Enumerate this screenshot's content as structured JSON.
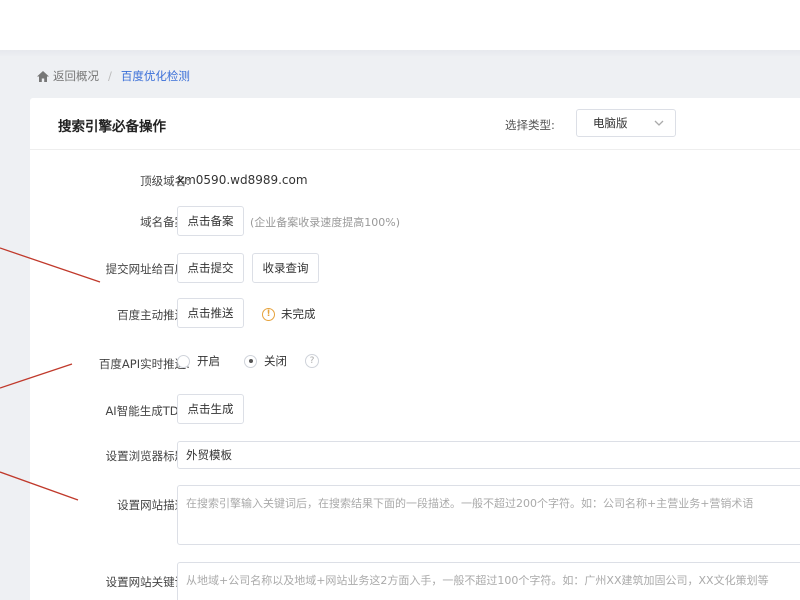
{
  "breadcrumb": {
    "back": "返回概况",
    "separator": "/",
    "current": "百度优化检测"
  },
  "panel": {
    "title": "搜索引擎必备操作",
    "type_label": "选择类型:",
    "type_value": "电脑版"
  },
  "rows": {
    "domain": {
      "label": "顶级域名:",
      "value": "xm0590.wd8989.com"
    },
    "record": {
      "label": "域名备案:",
      "button": "点击备案",
      "hint": "(企业备案收录速度提高100%)"
    },
    "submit": {
      "label": "提交网址给百度:",
      "button": "点击提交",
      "button2": "收录查询"
    },
    "push": {
      "label": "百度主动推送:",
      "button": "点击推送",
      "status_icon": "!",
      "status": "未完成"
    },
    "api": {
      "label": "百度API实时推送:",
      "option_on": "开启",
      "option_off": "关闭",
      "selected": "关闭",
      "help": "?"
    },
    "tdk": {
      "label": "AI智能生成TDK:",
      "button": "点击生成"
    },
    "browser_title": {
      "label": "设置浏览器标题:",
      "value": "外贸模板"
    },
    "description": {
      "label": "设置网站描述:",
      "placeholder": "在搜索引擎输入关键词后，在搜索结果下面的一段描述。一般不超过200个字符。如：公司名称+主营业务+营销术语"
    },
    "keywords": {
      "label": "设置网站关键词:",
      "placeholder": "从地域+公司名称以及地域+网站业务这2方面入手，一般不超过100个字符。如：广州XX建筑加固公司，XX文化策划等"
    }
  },
  "colors": {
    "accent": "#3a6fd8",
    "warning": "#e6a23c",
    "annotation": "#c0392b",
    "background": "#eef0f3"
  },
  "icons": {
    "home": "home-icon",
    "chevron": "chevron-down-icon",
    "warning": "warning-circle-icon",
    "help": "question-circle-icon"
  }
}
